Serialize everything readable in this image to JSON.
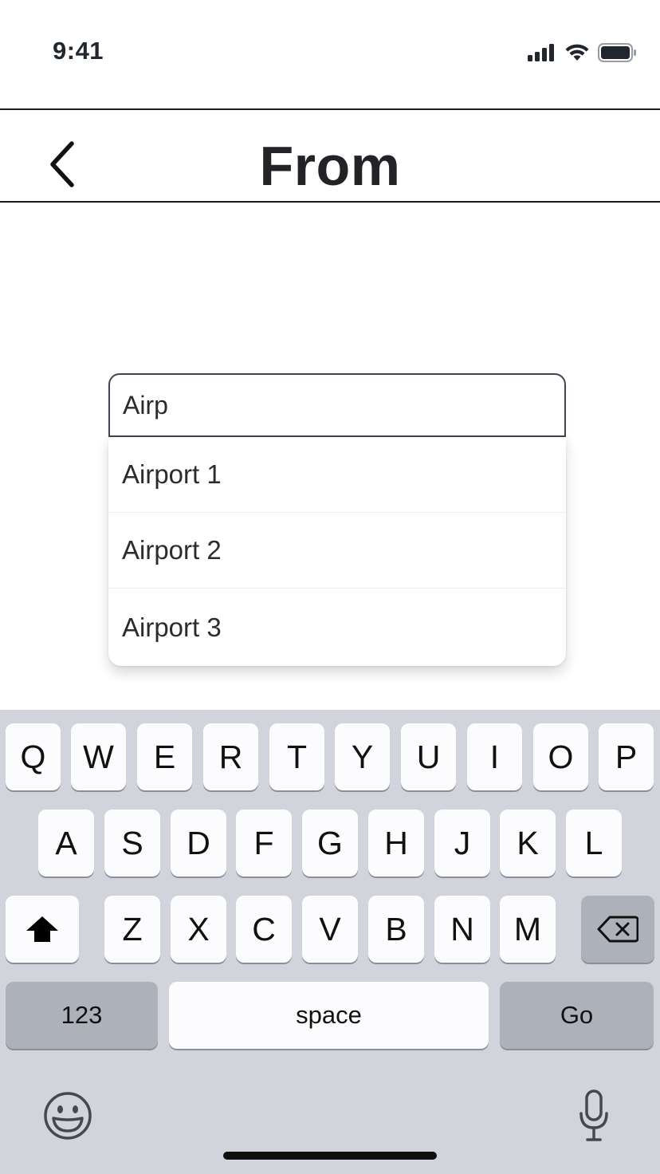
{
  "status_bar": {
    "time": "9:41"
  },
  "nav": {
    "title": "From"
  },
  "search": {
    "value": "Airp"
  },
  "suggestions": [
    "Airport 1",
    "Airport 2",
    "Airport 3"
  ],
  "keyboard": {
    "row1": [
      "Q",
      "W",
      "E",
      "R",
      "T",
      "Y",
      "U",
      "I",
      "O",
      "P"
    ],
    "row2": [
      "A",
      "S",
      "D",
      "F",
      "G",
      "H",
      "J",
      "K",
      "L"
    ],
    "row3": [
      "Z",
      "X",
      "C",
      "V",
      "B",
      "N",
      "M"
    ],
    "numbers_label": "123",
    "space_label": "space",
    "go_label": "Go"
  }
}
